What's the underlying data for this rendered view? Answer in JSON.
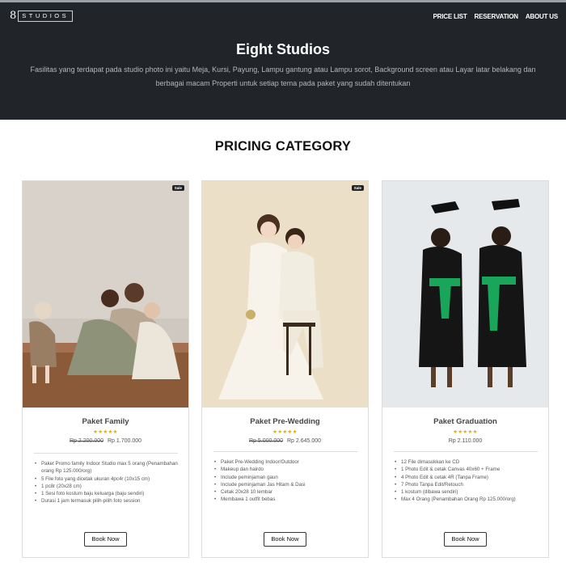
{
  "brand": {
    "number": "8",
    "name": "STUDIOS"
  },
  "nav": {
    "links": [
      "PRICE LIST",
      "RESERVATION",
      "ABOUT US"
    ]
  },
  "hero": {
    "title": "Eight Studios",
    "description": "Fasilitas yang terdapat pada studio photo ini yaitu Meja, Kursi, Payung, Lampu gantung atau Lampu sorot, Background screen atau Layar latar belakang dan berbagai macam Properti untuk setiap tema pada paket yang sudah ditentukan"
  },
  "section": {
    "title": "PRICING CATEGORY"
  },
  "cards": [
    {
      "badge": "Sale",
      "title": "Paket Family",
      "stars": "★★★★★",
      "price_old": "Rp 2.200.000",
      "price": "Rp 1.700.000",
      "features": [
        "Paket Promo family Indoor Studio max 5 orang (Penambahan orang Rp 125.000/org)",
        "5 File foto yang dicetak ukuran 4pc4r (10x15 cm)",
        "1 pc8r (20x28 cm)",
        "1 Sesi foto kostum baju keluarga (baju sendiri)",
        "Durasi 1 jam termasuk pilih-pilih foto session"
      ],
      "button": "Book Now"
    },
    {
      "badge": "Sale",
      "title": "Paket Pre-Wedding",
      "stars": "★★★★★",
      "price_old": "Rp 5.000.000",
      "price": "Rp 2.645.000",
      "features": [
        "Paket Pre-Wedding Indoor/Outdoor",
        "Makeup dan hairdo",
        "Include peminjaman gaun",
        "Include peminjaman Jas Hitam & Dasi",
        "Cetak 20x28 10 lembar",
        "Membawa 1 outfit bebas"
      ],
      "button": "Book Now"
    },
    {
      "badge": "",
      "title": "Paket Graduation",
      "stars": "★★★★★",
      "price_old": "",
      "price": "Rp 2.110.000",
      "features": [
        "12 File dimasukkan ke CD",
        "1 Photo Edit & cetak Canvas 40x60 + Frame",
        "4 Photo Edit & cetak 4R (Tanpa Frame)",
        "7 Photo Tanpa Edit/Retouch",
        "1 kostum (dibawa sendiri)",
        "Max 4 Orang (Penambahan Orang Rp 125.000/org)"
      ],
      "button": "Book Now"
    }
  ],
  "colors": {
    "header_bg": "#212529",
    "star": "#e0b000",
    "graduation_sash": "#1aa65a"
  }
}
